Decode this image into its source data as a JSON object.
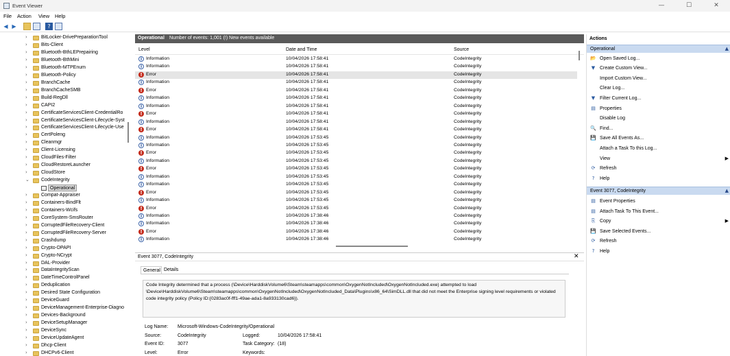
{
  "window": {
    "title": "Event Viewer",
    "minimize": "—",
    "maximize": "☐",
    "close": "✕"
  },
  "menu": [
    "File",
    "Action",
    "View",
    "Help"
  ],
  "toolbar": {
    "back": "◀",
    "forward": "▶"
  },
  "tree": {
    "items": [
      "BitLocker-DrivePreparationTool",
      "Bits-Client",
      "Bluetooth-BthLEPrepairing",
      "Bluetooth-BthMini",
      "Bluetooth-MTPEnum",
      "Bluetooth-Policy",
      "BranchCache",
      "BranchCacheSMB",
      "Build-RegDll",
      "CAPI2",
      "CertificateServicesClient-CredentialRo",
      "CertificateServicesClient-Lifecycle-Syst",
      "CertificateServicesClient-Lifecycle-Use",
      "CertPoleng",
      "Cleanmgr",
      "Client-Licensing",
      "CloudFiles-Filter",
      "CloudRestoreLauncher",
      "CloudStore",
      "CodeIntegrity"
    ],
    "selected": "Operational",
    "items_after": [
      "Compat-Appraiser",
      "Containers-BindFlt",
      "Containers-Wcifs",
      "CoreSystem-SmsRouter",
      "CorruptedFileRecovery-Client",
      "CorruptedFileRecovery-Server",
      "Crashdump",
      "Crypto-DPAPI",
      "Crypto-NCrypt",
      "DAL-Provider",
      "DataIntegrityScan",
      "DateTimeControlPanel",
      "Deduplication",
      "Desired State Configuration",
      "DeviceGuard",
      "DeviceManagement-Enterprise-Diagno",
      "Devices-Background",
      "DeviceSetupManager",
      "DeviceSync",
      "DeviceUpdateAgent",
      "Dhcp-Client",
      "DHCPv6-Client"
    ]
  },
  "log_header": {
    "name": "Operational",
    "count": "Number of events: 1,001 (!) New events available"
  },
  "grid": {
    "columns": [
      "Level",
      "Date and Time",
      "Source"
    ],
    "rows": [
      [
        "Information",
        "10/04/2026 17:58:41",
        "CodeIntegrity"
      ],
      [
        "Information",
        "10/04/2026 17:58:41",
        "CodeIntegrity"
      ],
      [
        "Error",
        "10/04/2026 17:58:41",
        "CodeIntegrity"
      ],
      [
        "Information",
        "10/04/2026 17:58:41",
        "CodeIntegrity"
      ],
      [
        "Error",
        "10/04/2026 17:58:41",
        "CodeIntegrity"
      ],
      [
        "Information",
        "10/04/2026 17:58:41",
        "CodeIntegrity"
      ],
      [
        "Information",
        "10/04/2026 17:58:41",
        "CodeIntegrity"
      ],
      [
        "Error",
        "10/04/2026 17:58:41",
        "CodeIntegrity"
      ],
      [
        "Information",
        "10/04/2026 17:58:41",
        "CodeIntegrity"
      ],
      [
        "Error",
        "10/04/2026 17:58:41",
        "CodeIntegrity"
      ],
      [
        "Information",
        "10/04/2026 17:53:45",
        "CodeIntegrity"
      ],
      [
        "Information",
        "10/04/2026 17:53:45",
        "CodeIntegrity"
      ],
      [
        "Error",
        "10/04/2026 17:53:45",
        "CodeIntegrity"
      ],
      [
        "Information",
        "10/04/2026 17:53:45",
        "CodeIntegrity"
      ],
      [
        "Error",
        "10/04/2026 17:53:45",
        "CodeIntegrity"
      ],
      [
        "Information",
        "10/04/2026 17:53:45",
        "CodeIntegrity"
      ],
      [
        "Information",
        "10/04/2026 17:53:45",
        "CodeIntegrity"
      ],
      [
        "Error",
        "10/04/2026 17:53:45",
        "CodeIntegrity"
      ],
      [
        "Information",
        "10/04/2026 17:53:45",
        "CodeIntegrity"
      ],
      [
        "Error",
        "10/04/2026 17:53:45",
        "CodeIntegrity"
      ],
      [
        "Information",
        "10/04/2026 17:38:46",
        "CodeIntegrity"
      ],
      [
        "Information",
        "10/04/2026 17:38:46",
        "CodeIntegrity"
      ],
      [
        "Error",
        "10/04/2026 17:38:46",
        "CodeIntegrity"
      ],
      [
        "Information",
        "10/04/2026 17:38:46",
        "CodeIntegrity"
      ]
    ],
    "selected_row": 2
  },
  "detail": {
    "title": "Event 3077, CodeIntegrity",
    "close": "✕",
    "tabs": [
      "General",
      "Details"
    ],
    "message": "Code Integrity determined that a process (\\Device\\HarddiskVolume6\\Steam\\steamapps\\common\\OxygenNotIncluded\\OxygenNotIncluded.exe) attempted to load \\Device\\HarddiskVolume6\\Steam\\steamapps\\common\\OxygenNotIncluded\\OxygenNotIncluded_Data\\Plugins\\x86_64\\SimDLL.dll that did not meet the Enterprise signing level requirements or violated code integrity policy (Policy ID:{0283ac0f-fff1-49ae-ada1-8a933130cad6}).",
    "log_name_label": "Log Name:",
    "log_name": "Microsoft-Windows-CodeIntegrity/Operational",
    "source_label": "Source:",
    "source": "CodeIntegrity",
    "logged_label": "Logged:",
    "logged": "10/04/2026 17:58:41",
    "event_id_label": "Event ID:",
    "event_id": "3077",
    "task_label": "Task Category:",
    "task": "(18)",
    "level_label": "Level:",
    "level": "Error",
    "keywords_label": "Keywords:"
  },
  "actions": {
    "title": "Actions",
    "section1": "Operational",
    "items1": [
      {
        "label": "Open Saved Log...",
        "icon": "📂"
      },
      {
        "label": "Create Custom View...",
        "icon": "▼"
      },
      {
        "label": "Import Custom View...",
        "icon": ""
      },
      {
        "label": "Clear Log...",
        "icon": ""
      },
      {
        "label": "Filter Current Log...",
        "icon": "▼"
      },
      {
        "label": "Properties",
        "icon": "▤"
      },
      {
        "label": "Disable Log",
        "icon": ""
      },
      {
        "label": "Find...",
        "icon": "🔍"
      },
      {
        "label": "Save All Events As...",
        "icon": "💾"
      },
      {
        "label": "Attach a Task To this Log...",
        "icon": ""
      },
      {
        "label": "View",
        "icon": "",
        "submenu": true
      },
      {
        "label": "Refresh",
        "icon": "⟳"
      },
      {
        "label": "Help",
        "icon": "?"
      }
    ],
    "section2": "Event 3077, CodeIntegrity",
    "items2": [
      {
        "label": "Event Properties",
        "icon": "▤"
      },
      {
        "label": "Attach Task To This Event...",
        "icon": "▤"
      },
      {
        "label": "Copy",
        "icon": "⎘",
        "submenu": true
      },
      {
        "label": "Save Selected Events...",
        "icon": "💾"
      },
      {
        "label": "Refresh",
        "icon": "⟳"
      },
      {
        "label": "Help",
        "icon": "?"
      }
    ]
  }
}
